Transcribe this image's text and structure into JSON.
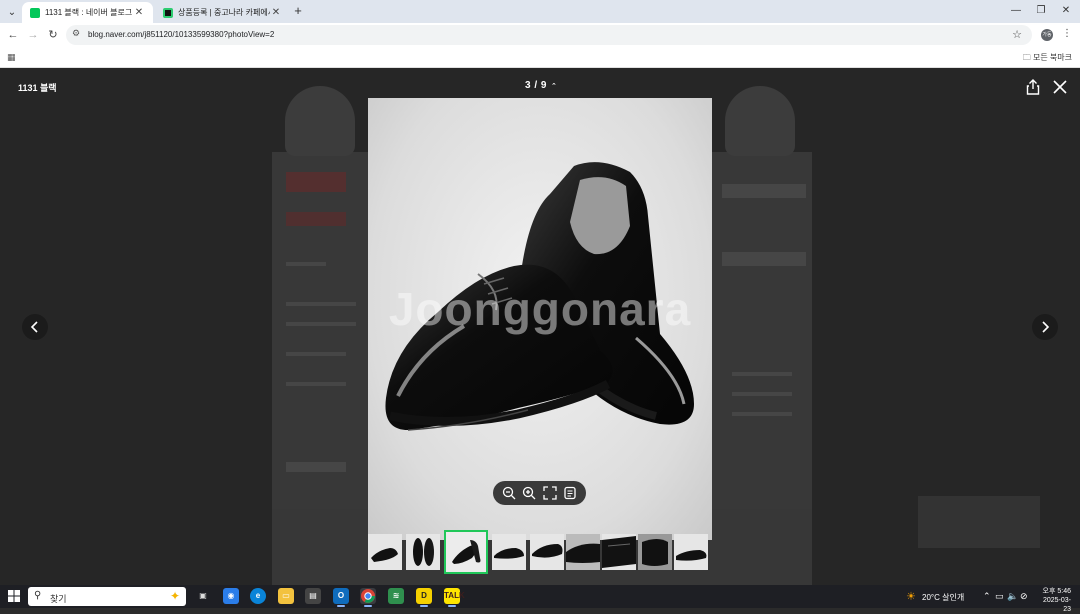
{
  "browser": {
    "tabs": [
      {
        "title": "1131 블랙 : 네이버 블로그",
        "active": true,
        "favicon_color": "#03c75a"
      },
      {
        "title": "상품등록 | 중고나라 카페에서",
        "active": false,
        "favicon_color": "#111111"
      }
    ],
    "new_tab_label": "+",
    "url": "blog.naver.com/j851120/10133599380?photoView=2",
    "profile_initials": "가동",
    "all_bookmarks_label": "모든 북마크"
  },
  "viewer": {
    "title": "1131 블랙",
    "counter": "3 / 9",
    "watermark": "Joonggonara",
    "current_index": 3,
    "total": 9,
    "thumbnail_count": 9,
    "active_thumb_color": "#20c759"
  },
  "taskbar": {
    "search_placeholder": "찾기",
    "weather": "20°C  살인개",
    "time": "오후 5:46",
    "date": "2025-03-23"
  }
}
